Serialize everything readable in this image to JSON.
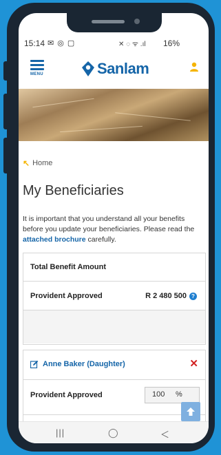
{
  "status_bar": {
    "time": "15:14",
    "left_icons": "✉ ◎ ▢",
    "right_icons": "✕ ◌ ᯤ .ıl",
    "battery": "16%"
  },
  "header": {
    "menu_label": "MENU",
    "brand": "Sanlam"
  },
  "breadcrumb": {
    "label": "Home"
  },
  "page": {
    "title": "My Beneficiaries",
    "intro_before": "It is important that you understand all your benefits before you update your beneficiaries. Please read the ",
    "intro_link": "attached brochure",
    "intro_after": " carefully."
  },
  "benefits": {
    "header": "Total Benefit Amount",
    "rows": [
      {
        "label": "Provident Approved",
        "value": "R 2 480 500"
      }
    ]
  },
  "beneficiary": {
    "name": "Anne Baker (Daughter)",
    "fund_label": "Provident Approved",
    "percentage": "100",
    "unit": "%"
  },
  "nav": {
    "recent": "|||",
    "home": "◯",
    "back": "＜"
  },
  "colors": {
    "brand_blue": "#1565a8",
    "accent_yellow": "#f5b400",
    "remove_red": "#d22222",
    "background": "#1f93d6"
  }
}
